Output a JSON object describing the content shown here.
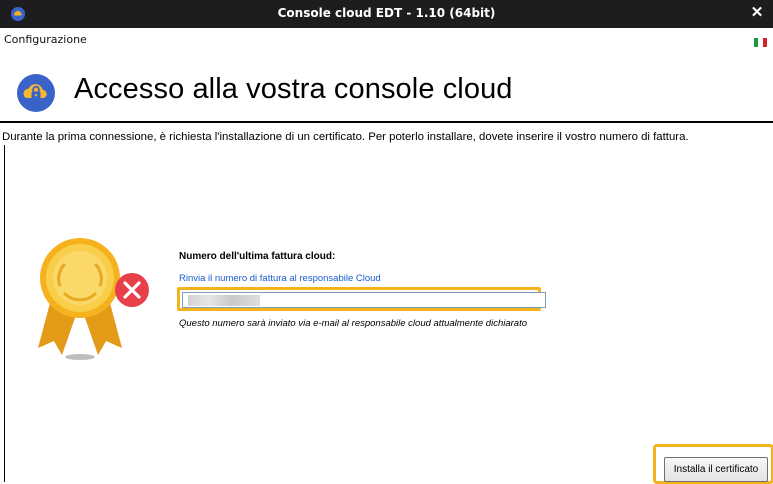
{
  "window": {
    "title": "Console cloud EDT - 1.10 (64bit)",
    "close_glyph": "✕",
    "app_icon": "cloud-lock-icon"
  },
  "header": {
    "section": "Configurazione",
    "language_flag": "italy-flag-icon",
    "title": "Accesso alla vostra console cloud",
    "icon": "cloud-lock-icon"
  },
  "intro_text": "Durante la prima connessione, è richiesta l'installazione di un certificato. Per poterlo installare, dovete inserire il vostro numero di fattura.",
  "form": {
    "label": "Numero dell'ultima fattura cloud:",
    "resend_link": "Rinvia il numero di fattura al responsabile Cloud",
    "invoice_value": "",
    "hint": "Questo numero sarà inviato via e-mail al responsabile cloud attualmente dichiarato",
    "illustration": "certificate-medal-error-icon"
  },
  "actions": {
    "install_label": "Installa il certificato"
  },
  "colors": {
    "titlebar": "#1d1d1f",
    "accent_highlight": "#f2b31c",
    "link": "#1a5bd0",
    "header_icon_bg": "#3a63c9",
    "error_badge": "#e8404a"
  }
}
